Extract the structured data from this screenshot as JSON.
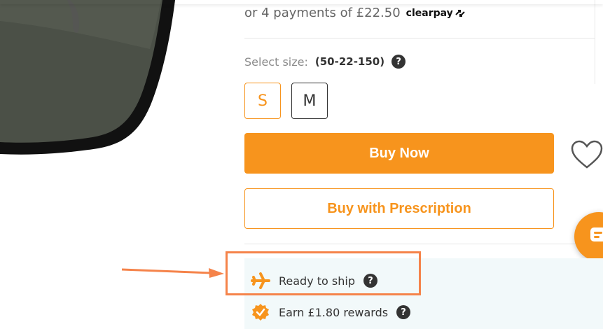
{
  "payment": {
    "installments_text": "or 4 payments of £22.50",
    "provider": "clearpay"
  },
  "size": {
    "label": "Select size:",
    "value": "(50-22-150)",
    "options": [
      "S",
      "M"
    ],
    "selected": "S"
  },
  "actions": {
    "buy_now": "Buy Now",
    "buy_with_prescription": "Buy with Prescription"
  },
  "info": {
    "shipping": "Ready to ship",
    "rewards": "Earn £1.80 rewards"
  },
  "help_glyph": "?",
  "colors": {
    "accent": "#f7941d",
    "highlight": "#f5834a",
    "info_bg": "#f2f9fa"
  },
  "icons": [
    "heart-icon",
    "airplane-icon",
    "rewards-badge-icon",
    "help-icon",
    "chat-icon",
    "clearpay-arrows-icon"
  ]
}
